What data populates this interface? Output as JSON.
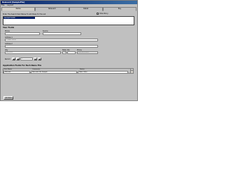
{
  "window": {
    "title": "Relevant [SampleFile]"
  },
  "menu": [
    "File",
    "Layout"
  ],
  "tabs": [
    "Name",
    "Relevant",
    "Detail",
    "Pay"
  ],
  "hint": "Enter The Search Item Below To Add Rows To The List",
  "visible_policy": {
    "label": "Hide Policy",
    "checked": false
  },
  "list": {
    "selected": "Leonard Smith"
  },
  "your_fields": {
    "title": "Your Fields",
    "phone_label": "Phone",
    "phone_placeholder": "",
    "source_label": "Source",
    "source_placeholder": "",
    "address1_label": "Address 1",
    "address1_value": "1 Main Street",
    "address2_label": "Address 2",
    "address2_value": "",
    "city_label": "City",
    "city_value": "Anytown",
    "state_label": "State",
    "zip_label": "Zip",
    "state_value": "MA",
    "zip_value": "",
    "phone2_label": "Phone",
    "phone2_value": "555-555-5555"
  },
  "record": {
    "label": "Record",
    "value": "1"
  },
  "app_fields": {
    "title": "Application Fields For Each Name File",
    "col1": "First Name",
    "col2": "Comments",
    "col3": "Status",
    "v1": "SPersist",
    "v2": "Relevant File Sample",
    "v3": "Main Office"
  },
  "apply_button": "Add Row"
}
